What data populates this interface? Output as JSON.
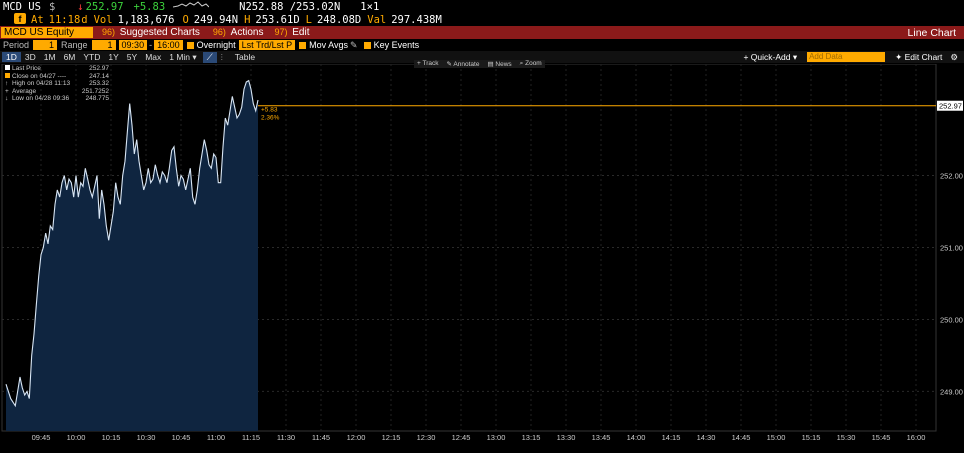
{
  "header": {
    "ticker": "MCD US",
    "currency": "$",
    "direction_glyph": "↓",
    "last": "252.97",
    "change": "+5.83",
    "bid_ask": "N252.88 /253.02N",
    "size": "1×1",
    "at_label": "At",
    "time": "11:18",
    "time_suffix": "d",
    "vol_label": "Vol",
    "volume": "1,183,676",
    "open_label": "O",
    "open": "249.94N",
    "high_label": "H",
    "high": "253.61D",
    "low_label": "L",
    "low": "248.08D",
    "val_label": "Val",
    "value": "297.438M"
  },
  "toolbar": {
    "security": "MCD US Equity",
    "item1_num": "96)",
    "item1_label": "Suggested Charts",
    "item2_num": "96)",
    "item2_label": "Actions",
    "item3_num": "97)",
    "item3_label": "Edit",
    "chart_type": "Line Chart"
  },
  "settings": {
    "period_label": "Period",
    "period_value": "1",
    "range_label": "Range",
    "range_value": "1",
    "start_time": "09:30",
    "end_time": "16:00",
    "overnight_label": "Overnight",
    "lst_label": "Lst Trd/Lst P",
    "mov_avgs_label": "Mov Avgs",
    "key_events_label": "Key Events"
  },
  "tabs": {
    "items": [
      "1D",
      "3D",
      "1M",
      "6M",
      "YTD",
      "1Y",
      "5Y",
      "Max"
    ],
    "interval": "1 Min",
    "table_label": "Table",
    "quick_add": "Quick-Add",
    "add_data_placeholder": "Add Data",
    "edit_chart": "Edit Chart"
  },
  "chart_tools": [
    "Track",
    "Annotate",
    "News",
    "Zoom"
  ],
  "colors": {
    "amber": "#ffaa00",
    "up": "#3cd23c",
    "down": "#ff3b3b",
    "line": "#d8e6f5",
    "area": "#0f2540",
    "bg": "#000000",
    "toolbar": "#8b1a1a"
  },
  "legend": {
    "items": [
      {
        "label": "Last Price",
        "value": "252.97"
      },
      {
        "label": "Close on 04/27 ----",
        "value": "247.14"
      },
      {
        "label": "High on 04/28 11:13",
        "value": "253.32"
      },
      {
        "label": "Average",
        "value": "251.7252"
      },
      {
        "label": "Low on 04/28 09:36",
        "value": "248.775"
      }
    ]
  },
  "chart_data": {
    "type": "area",
    "ylim": [
      248.45,
      253.55
    ],
    "yticks": [
      249.0,
      250.0,
      251.0,
      252.0
    ],
    "ytick_labels": [
      "249.00",
      "250.00",
      "251.00",
      "252.00"
    ],
    "last_price_label": "252.97",
    "change_label": "+5.83",
    "change_pct_label": "2.36%",
    "xtick_labels": [
      "09:45",
      "10:00",
      "10:15",
      "10:30",
      "10:45",
      "11:00",
      "11:15",
      "11:30",
      "11:45",
      "12:00",
      "12:15",
      "12:30",
      "12:45",
      "13:00",
      "13:15",
      "13:30",
      "13:45",
      "14:00",
      "14:15",
      "14:30",
      "14:45",
      "15:00",
      "15:15",
      "15:30",
      "15:45",
      "16:00"
    ],
    "x": [
      "09:30",
      "09:32",
      "09:34",
      "09:36",
      "09:37",
      "09:38",
      "09:39",
      "09:40",
      "09:41",
      "09:42",
      "09:43",
      "09:44",
      "09:45",
      "09:46",
      "09:47",
      "09:48",
      "09:49",
      "09:50",
      "09:51",
      "09:52",
      "09:53",
      "09:54",
      "09:55",
      "09:56",
      "09:57",
      "09:58",
      "09:59",
      "10:00",
      "10:01",
      "10:02",
      "10:03",
      "10:04",
      "10:05",
      "10:06",
      "10:07",
      "10:08",
      "10:09",
      "10:10",
      "10:11",
      "10:12",
      "10:13",
      "10:14",
      "10:15",
      "10:16",
      "10:17",
      "10:18",
      "10:19",
      "10:20",
      "10:21",
      "10:22",
      "10:23",
      "10:24",
      "10:25",
      "10:26",
      "10:27",
      "10:28",
      "10:29",
      "10:30",
      "10:31",
      "10:32",
      "10:33",
      "10:34",
      "10:35",
      "10:36",
      "10:37",
      "10:38",
      "10:39",
      "10:40",
      "10:41",
      "10:42",
      "10:43",
      "10:44",
      "10:45",
      "10:46",
      "10:47",
      "10:48",
      "10:49",
      "10:50",
      "10:51",
      "10:52",
      "10:53",
      "10:54",
      "10:55",
      "10:56",
      "10:57",
      "10:58",
      "10:59",
      "11:00",
      "11:01",
      "11:02",
      "11:03",
      "11:04",
      "11:05",
      "11:06",
      "11:07",
      "11:08",
      "11:09",
      "11:10",
      "11:11",
      "11:12",
      "11:13",
      "11:14",
      "11:15",
      "11:16",
      "11:17",
      "11:18"
    ],
    "y": [
      249.1,
      248.9,
      248.8,
      249.2,
      249.05,
      248.95,
      249.0,
      248.9,
      249.5,
      249.8,
      250.2,
      250.6,
      250.9,
      251.0,
      251.2,
      251.05,
      251.3,
      251.25,
      251.6,
      251.8,
      251.7,
      251.9,
      252.0,
      251.8,
      251.95,
      251.9,
      251.7,
      252.0,
      251.7,
      251.9,
      251.85,
      252.1,
      251.95,
      251.8,
      251.7,
      251.85,
      252.0,
      251.4,
      251.8,
      251.6,
      251.3,
      251.1,
      251.3,
      251.5,
      251.9,
      251.7,
      251.6,
      252.0,
      252.2,
      252.6,
      253.0,
      252.7,
      252.3,
      252.5,
      252.2,
      252.0,
      251.8,
      251.9,
      252.1,
      251.9,
      251.95,
      252.15,
      252.0,
      251.9,
      252.05,
      252.0,
      251.9,
      252.1,
      252.35,
      252.4,
      252.1,
      251.85,
      252.0,
      251.95,
      251.8,
      251.95,
      252.1,
      251.7,
      251.6,
      251.8,
      252.1,
      252.3,
      252.5,
      252.35,
      252.15,
      252.1,
      252.3,
      252.25,
      251.9,
      251.9,
      252.4,
      252.8,
      252.7,
      252.9,
      253.1,
      252.95,
      252.8,
      252.85,
      252.95,
      253.2,
      253.3,
      253.32,
      253.2,
      253.0,
      252.9,
      253.05,
      252.95,
      252.97
    ],
    "session_start": "09:30",
    "session_end": "16:00",
    "last_price": 252.97
  }
}
